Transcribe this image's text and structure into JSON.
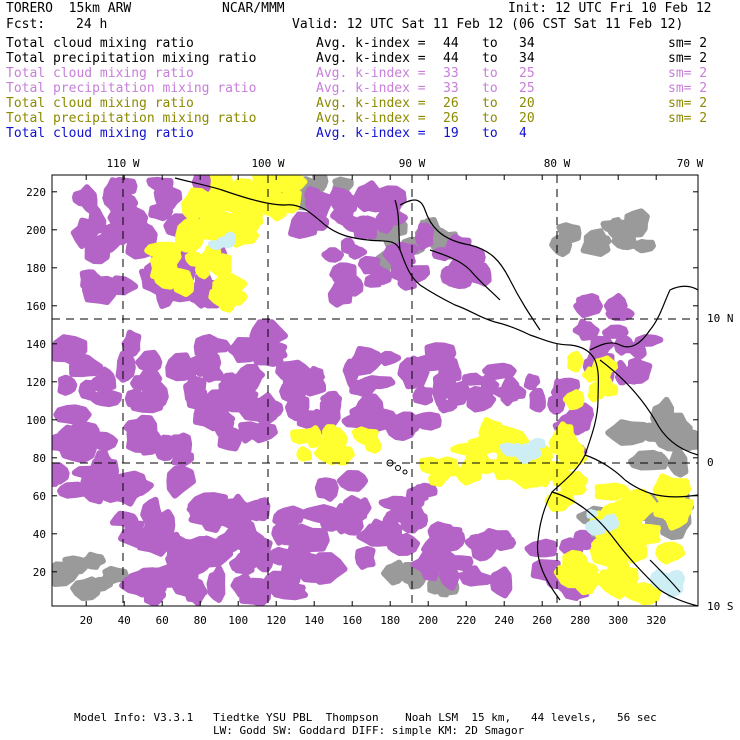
{
  "header": {
    "model": "TORERO  15km ARW",
    "org": "NCAR/MMM",
    "init": "Init: 12 UTC Fri 10 Feb 12",
    "fcst_label": "Fcst:",
    "fcst_value": "24 h",
    "valid": "Valid: 12 UTC Sat 11 Feb 12 (06 CST Sat 11 Feb 12)"
  },
  "legend": [
    {
      "field": "Total cloud mixing ratio",
      "stat": "Avg. k-index =",
      "from": "44",
      "to_word": "to",
      "to": "34",
      "sm": "sm= 2",
      "color": "#000000"
    },
    {
      "field": "Total precipitation mixing ratio",
      "stat": "Avg. k-index =",
      "from": "44",
      "to_word": "to",
      "to": "34",
      "sm": "sm= 2",
      "color": "#000000"
    },
    {
      "field": "Total cloud mixing ratio",
      "stat": "Avg. k-index =",
      "from": "33",
      "to_word": "to",
      "to": "25",
      "sm": "sm= 2",
      "color": "#c77fd9"
    },
    {
      "field": "Total precipitation mixing ratio",
      "stat": "Avg. k-index =",
      "from": "33",
      "to_word": "to",
      "to": "25",
      "sm": "sm= 2",
      "color": "#c77fd9"
    },
    {
      "field": "Total cloud mixing ratio",
      "stat": "Avg. k-index =",
      "from": "26",
      "to_word": "to",
      "to": "20",
      "sm": "sm= 2",
      "color": "#8c8a00"
    },
    {
      "field": "Total precipitation mixing ratio",
      "stat": "Avg. k-index =",
      "from": "26",
      "to_word": "to",
      "to": "20",
      "sm": "sm= 2",
      "color": "#8c8a00"
    },
    {
      "field": "Total cloud mixing ratio",
      "stat": "Avg. k-index =",
      "from": "19",
      "to_word": "to",
      "to": "4",
      "sm": "",
      "color": "#1010d0"
    }
  ],
  "map": {
    "y_ticks": [
      "20",
      "40",
      "60",
      "80",
      "100",
      "120",
      "140",
      "160",
      "180",
      "200",
      "220"
    ],
    "x_ticks": [
      "20",
      "40",
      "60",
      "80",
      "100",
      "120",
      "140",
      "160",
      "180",
      "200",
      "220",
      "240",
      "260",
      "280",
      "300",
      "320"
    ],
    "lon_labels": [
      "110 W",
      "100 W",
      "90 W",
      "80 W",
      "70 W"
    ],
    "lat_labels": [
      "10 N",
      "0",
      "10 S"
    ],
    "colors": {
      "gray": "#9a9a9a",
      "purple": "#b463c6",
      "yellow": "#ffff30",
      "cyan": "#cdeef5"
    }
  },
  "footer": {
    "line1": "Model Info: V3.3.1   Tiedtke YSU PBL  Thompson    Noah LSM  15 km,   44 levels,   56 sec",
    "line2": "LW: Godd SW: Goddard DIFF: simple KM: 2D Smagor"
  }
}
